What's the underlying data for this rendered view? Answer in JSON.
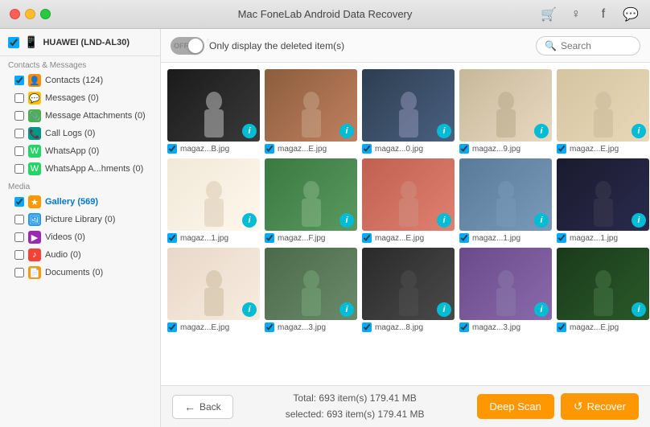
{
  "titleBar": {
    "title": "Mac FoneLab Android Data Recovery",
    "trafficLights": [
      "close",
      "minimize",
      "maximize"
    ],
    "icons": [
      "cart-icon",
      "user-icon",
      "facebook-icon",
      "chat-icon"
    ]
  },
  "sidebar": {
    "device": {
      "name": "HUAWEI (LND-AL30)",
      "checked": true
    },
    "sections": [
      {
        "label": "Contacts & Messages",
        "items": [
          {
            "id": "contacts",
            "label": "Contacts (124)",
            "checked": true,
            "icon": "person",
            "iconClass": "icon-orange"
          },
          {
            "id": "messages",
            "label": "Messages (0)",
            "checked": false,
            "icon": "msg",
            "iconClass": "icon-yellow"
          },
          {
            "id": "msg-attach",
            "label": "Message Attachments (0)",
            "checked": false,
            "icon": "attach",
            "iconClass": "icon-green"
          },
          {
            "id": "call-logs",
            "label": "Call Logs (0)",
            "checked": false,
            "icon": "phone",
            "iconClass": "icon-teal"
          },
          {
            "id": "whatsapp",
            "label": "WhatsApp (0)",
            "checked": false,
            "icon": "wa",
            "iconClass": "icon-whatsapp"
          },
          {
            "id": "wa-attach",
            "label": "WhatsApp A...hments (0)",
            "checked": false,
            "icon": "wa",
            "iconClass": "icon-whatsapp"
          }
        ]
      },
      {
        "label": "Media",
        "items": [
          {
            "id": "gallery",
            "label": "Gallery (569)",
            "checked": true,
            "icon": "★",
            "iconClass": "icon-gallery",
            "active": true
          },
          {
            "id": "picture-lib",
            "label": "Picture Library (0)",
            "checked": false,
            "icon": "pic",
            "iconClass": "icon-picture"
          },
          {
            "id": "videos",
            "label": "Videos (0)",
            "checked": false,
            "icon": "▶",
            "iconClass": "icon-video"
          },
          {
            "id": "audio",
            "label": "Audio (0)",
            "checked": false,
            "icon": "♪",
            "iconClass": "icon-audio"
          },
          {
            "id": "documents",
            "label": "Documents (0)",
            "checked": false,
            "icon": "doc",
            "iconClass": "icon-docs"
          }
        ]
      }
    ]
  },
  "toolbar": {
    "toggle": {
      "state": "OFF",
      "label": "Only display the deleted item(s)"
    },
    "search": {
      "placeholder": "Search"
    }
  },
  "grid": {
    "rows": [
      {
        "cells": [
          {
            "label": "magaz...B.jpg",
            "checked": true,
            "photoClass": "photo-1"
          },
          {
            "label": "magaz...E.jpg",
            "checked": true,
            "photoClass": "photo-2"
          },
          {
            "label": "magaz...0.jpg",
            "checked": true,
            "photoClass": "photo-3"
          },
          {
            "label": "magaz...9.jpg",
            "checked": true,
            "photoClass": "photo-4"
          },
          {
            "label": "magaz...E.jpg",
            "checked": true,
            "photoClass": "photo-5"
          }
        ]
      },
      {
        "cells": [
          {
            "label": "magaz...1.jpg",
            "checked": true,
            "photoClass": "photo-6"
          },
          {
            "label": "magaz...F.jpg",
            "checked": true,
            "photoClass": "photo-7"
          },
          {
            "label": "magaz...E.jpg",
            "checked": true,
            "photoClass": "photo-8"
          },
          {
            "label": "magaz...1.jpg",
            "checked": true,
            "photoClass": "photo-9"
          },
          {
            "label": "magaz...1.jpg",
            "checked": true,
            "photoClass": "photo-10"
          }
        ]
      },
      {
        "cells": [
          {
            "label": "magaz...E.jpg",
            "checked": true,
            "photoClass": "photo-11"
          },
          {
            "label": "magaz...3.jpg",
            "checked": true,
            "photoClass": "photo-12"
          },
          {
            "label": "magaz...8.jpg",
            "checked": true,
            "photoClass": "photo-13"
          },
          {
            "label": "magaz...3.jpg",
            "checked": true,
            "photoClass": "photo-14"
          },
          {
            "label": "magaz...E.jpg",
            "checked": true,
            "photoClass": "photo-15"
          }
        ]
      }
    ]
  },
  "bottomBar": {
    "back_label": "Back",
    "status_line1": "Total: 693 item(s) 179.41 MB",
    "status_line2": "selected: 693 item(s) 179.41 MB",
    "deep_scan_label": "Deep Scan",
    "recover_label": "Recover"
  }
}
